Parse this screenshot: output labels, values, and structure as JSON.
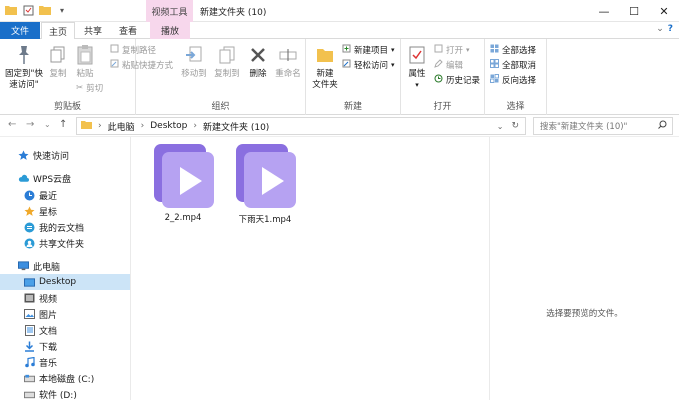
{
  "window": {
    "title": "新建文件夹 (10)",
    "context_tab": "视频工具"
  },
  "tabs": [
    "文件",
    "主页",
    "共享",
    "查看",
    "播放"
  ],
  "ribbon": {
    "clipboard": {
      "label": "剪贴板",
      "pin": "固定到\"快\n速访问\"",
      "copy": "复制",
      "paste": "粘贴",
      "copy_path": "复制路径",
      "paste_shortcut": "粘贴快捷方式",
      "cut": "剪切"
    },
    "organize": {
      "label": "组织",
      "move_to": "移动到",
      "copy_to": "复制到",
      "delete": "删除",
      "rename": "重命名"
    },
    "new": {
      "label": "新建",
      "new_folder": "新建\n文件夹",
      "new_item": "新建项目",
      "easy_access": "轻松访问"
    },
    "open": {
      "label": "打开",
      "properties": "属性",
      "open": "打开",
      "edit": "编辑",
      "history": "历史记录"
    },
    "select": {
      "label": "选择",
      "select_all": "全部选择",
      "select_none": "全部取消",
      "invert": "反向选择"
    }
  },
  "address": {
    "crumbs": [
      "此电脑",
      "Desktop",
      "新建文件夹 (10)"
    ],
    "search_placeholder": "搜索\"新建文件夹 (10)\""
  },
  "nav": {
    "items": [
      {
        "label": "快速访问",
        "icon": "star-icon",
        "level": 0
      },
      {
        "label": "WPS云盘",
        "icon": "cloud-icon",
        "level": 0
      },
      {
        "label": "最近",
        "icon": "clock-icon",
        "level": 1
      },
      {
        "label": "星标",
        "icon": "star-icon",
        "level": 1
      },
      {
        "label": "我的云文档",
        "icon": "cloud-doc-icon",
        "level": 1
      },
      {
        "label": "共享文件夹",
        "icon": "share-folder-icon",
        "level": 1
      },
      {
        "label": "此电脑",
        "icon": "computer-icon",
        "level": 0
      },
      {
        "label": "Desktop",
        "icon": "desktop-icon",
        "level": 1
      },
      {
        "label": "视频",
        "icon": "video-icon",
        "level": 1
      },
      {
        "label": "图片",
        "icon": "picture-icon",
        "level": 1
      },
      {
        "label": "文档",
        "icon": "document-icon",
        "level": 1
      },
      {
        "label": "下载",
        "icon": "download-icon",
        "level": 1
      },
      {
        "label": "音乐",
        "icon": "music-icon",
        "level": 1
      },
      {
        "label": "本地磁盘 (C:)",
        "icon": "drive-icon",
        "level": 1
      },
      {
        "label": "软件 (D:)",
        "icon": "drive-icon",
        "level": 1
      }
    ]
  },
  "files": [
    {
      "name": "2_2.mp4"
    },
    {
      "name": "下雨天1.mp4"
    }
  ],
  "preview": {
    "empty_text": "选择要预览的文件。"
  },
  "colors": {
    "accent": "#1a6fc9",
    "context": "#f7d7ec",
    "selected": "#cce4f7",
    "video_icon": "#9d7ee8"
  }
}
